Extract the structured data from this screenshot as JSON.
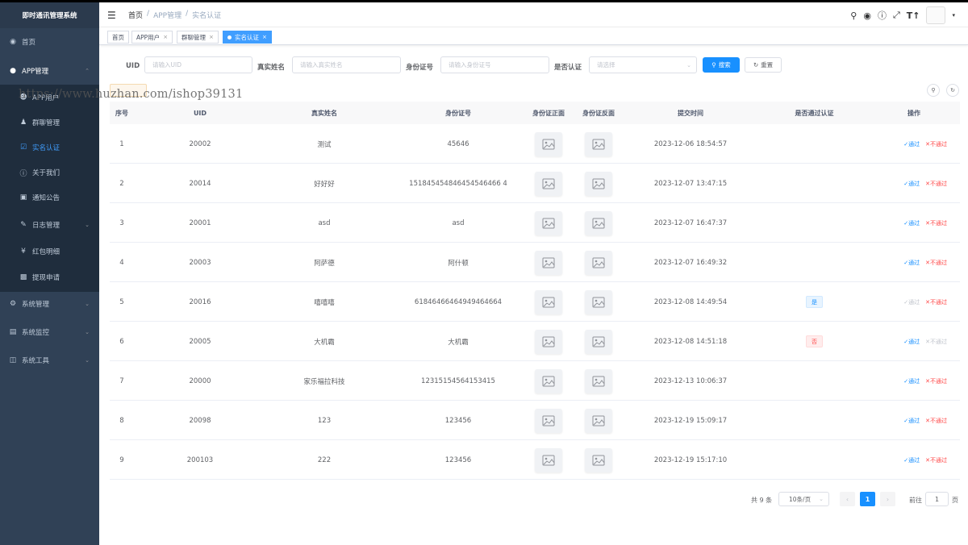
{
  "sidebar": {
    "logo": "即时通讯管理系统",
    "items": [
      {
        "label": "首页",
        "icon": "dashboard-icon"
      },
      {
        "label": "APP管理",
        "icon": "globe-icon"
      },
      {
        "label": "APP用户",
        "icon": "user-icon"
      },
      {
        "label": "群聊管理",
        "icon": "peoples-icon"
      },
      {
        "label": "实名认证",
        "icon": "checkbox-icon"
      },
      {
        "label": "关于我们",
        "icon": "question-icon"
      },
      {
        "label": "通知公告",
        "icon": "message-icon"
      },
      {
        "label": "日志管理",
        "icon": "log-icon"
      },
      {
        "label": "红包明细",
        "icon": "yen-icon"
      },
      {
        "label": "提现申请",
        "icon": "wallet-icon"
      },
      {
        "label": "系统管理",
        "icon": "system-icon"
      },
      {
        "label": "系统监控",
        "icon": "monitor-icon"
      },
      {
        "label": "系统工具",
        "icon": "tool-icon"
      }
    ]
  },
  "header": {
    "breadcrumb": [
      "首页",
      "/",
      "APP管理",
      "/",
      "实名认证"
    ]
  },
  "tags": [
    {
      "label": "首页"
    },
    {
      "label": "APP用户",
      "close": "×"
    },
    {
      "label": "群聊管理",
      "close": "×"
    },
    {
      "label": "实名认证",
      "close": "×"
    }
  ],
  "search": {
    "uid_label": "UID",
    "uid_placeholder": "请输入UID",
    "name_label": "真实姓名",
    "name_placeholder": "请输入真实姓名",
    "id_label": "身份证号",
    "id_placeholder": "请输入身份证号",
    "passed_label": "是否认证",
    "passed_placeholder": "请选择",
    "search_btn": "搜索",
    "reset_btn": "重置"
  },
  "watermark": "https://www.huzhan.com/ishop39131",
  "table": {
    "columns": [
      "序号",
      "UID",
      "真实姓名",
      "身份证号",
      "身份证正面",
      "身份证反面",
      "提交时间",
      "是否通过认证",
      "操作"
    ],
    "pass_label": "✓通过",
    "fail_label": "✕不通过",
    "rows": [
      {
        "no": "1",
        "uid": "20002",
        "name": "测试",
        "idno": "45646",
        "time": "2023-12-06 18:54:57",
        "status": "",
        "status_type": "",
        "pass_disabled": false,
        "fail_disabled": false
      },
      {
        "no": "2",
        "uid": "20014",
        "name": "好好好",
        "idno": "151845454846454546466 4",
        "time": "2023-12-07 13:47:15",
        "status": "",
        "status_type": "",
        "pass_disabled": false,
        "fail_disabled": false
      },
      {
        "no": "3",
        "uid": "20001",
        "name": "asd",
        "idno": "asd",
        "time": "2023-12-07 16:47:37",
        "status": "",
        "status_type": "",
        "pass_disabled": false,
        "fail_disabled": false
      },
      {
        "no": "4",
        "uid": "20003",
        "name": "阿萨德",
        "idno": "阿什顿",
        "time": "2023-12-07 16:49:32",
        "status": "",
        "status_type": "",
        "pass_disabled": false,
        "fail_disabled": false
      },
      {
        "no": "5",
        "uid": "20016",
        "name": "嘻嘻嘻",
        "idno": "61846466464949464664",
        "time": "2023-12-08 14:49:54",
        "status": "是",
        "status_type": "yes",
        "pass_disabled": true,
        "fail_disabled": false
      },
      {
        "no": "6",
        "uid": "20005",
        "name": "大机霸",
        "idno": "大机霸",
        "time": "2023-12-08 14:51:18",
        "status": "否",
        "status_type": "no",
        "pass_disabled": false,
        "fail_disabled": true
      },
      {
        "no": "7",
        "uid": "20000",
        "name": "家乐福拉科技",
        "idno": "12315154564153415",
        "time": "2023-12-13 10:06:37",
        "status": "",
        "status_type": "",
        "pass_disabled": false,
        "fail_disabled": false
      },
      {
        "no": "8",
        "uid": "20098",
        "name": "123",
        "idno": "123456",
        "time": "2023-12-19 15:09:17",
        "status": "",
        "status_type": "",
        "pass_disabled": false,
        "fail_disabled": false
      },
      {
        "no": "9",
        "uid": "200103",
        "name": "222",
        "idno": "123456",
        "time": "2023-12-19 15:17:10",
        "status": "",
        "status_type": "",
        "pass_disabled": false,
        "fail_disabled": false
      }
    ]
  },
  "pagination": {
    "total": "共 9 条",
    "page_size": "10条/页",
    "prev": "‹",
    "current": "1",
    "next": "›",
    "goto_label": "前往",
    "goto_value": "1",
    "page_suffix": "页"
  },
  "colors": {
    "primary": "#1890ff",
    "danger": "#ff4949",
    "sidebar": "#304156",
    "active_menu": "#409eff"
  }
}
